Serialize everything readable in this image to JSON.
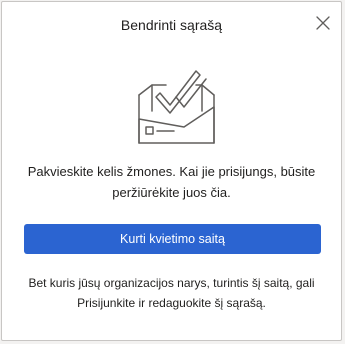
{
  "dialog": {
    "title": "Bendrinti sąrašą",
    "close_icon": "close-icon",
    "illustration_icon": "envelope-checkmark-icon",
    "invite_line1": "Pakvieskite kelis žmones. Kai jie prisijungs, būsite",
    "invite_line2": "peržiūrėkite juos čia.",
    "create_link_button": "Kurti kvietimo saitą",
    "footer_line1": "Bet kuris jūsų organizacijos narys, turintis šį saitą, gali",
    "footer_line2": "Prisijunkite ir redaguokite šį sąrašą.",
    "colors": {
      "primary_button": "#2b64d1",
      "text": "#201f1e",
      "illustration_stroke": "#605e5c"
    }
  }
}
